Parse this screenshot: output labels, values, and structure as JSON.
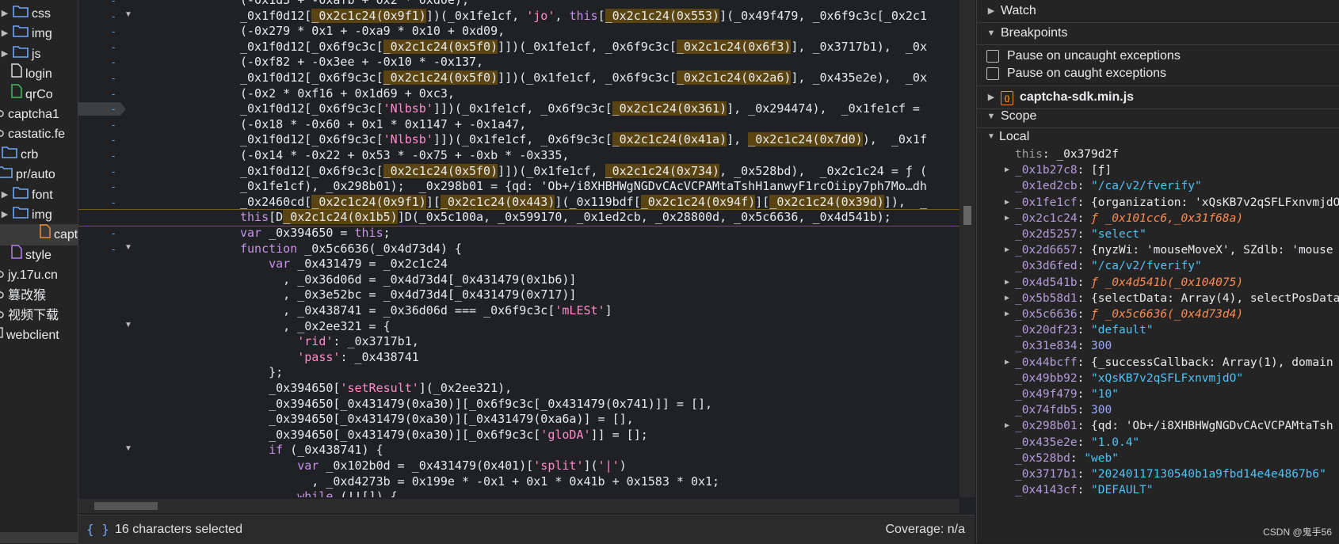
{
  "tree": {
    "items": [
      {
        "label": "css",
        "type": "folder",
        "expand": "▶"
      },
      {
        "label": "img",
        "type": "folder",
        "expand": "▶"
      },
      {
        "label": "js",
        "type": "folder",
        "expand": "▶"
      },
      {
        "label": "login",
        "type": "file-white",
        "expand": ""
      },
      {
        "label": "qrCo",
        "type": "file-green",
        "expand": ""
      },
      {
        "label": "captcha1",
        "type": "cloud",
        "expand": ""
      },
      {
        "label": "castatic.fe",
        "type": "cloud",
        "expand": ""
      },
      {
        "label": "crb",
        "type": "folder",
        "expand": "▶"
      },
      {
        "label": "pr/auto",
        "type": "folder",
        "expand": "▼"
      },
      {
        "label": "font",
        "type": "folder",
        "expand": "▶"
      },
      {
        "label": "img",
        "type": "folder",
        "expand": "▶"
      },
      {
        "label": "capto",
        "type": "file-orange",
        "expand": ""
      },
      {
        "label": "style",
        "type": "file-purple",
        "expand": ""
      },
      {
        "label": "jy.17u.cn",
        "type": "cloud",
        "expand": ""
      },
      {
        "label": "篡改猴",
        "type": "cloud",
        "expand": ""
      },
      {
        "label": "视频下载",
        "type": "cloud",
        "expand": ""
      },
      {
        "label": "webclient",
        "type": "square",
        "expand": ""
      }
    ]
  },
  "code_lines": [
    {
      "text": "(-0x1d3 + -0xafb + 0x2 * 0xd0e),",
      "hl": false
    },
    {
      "text": "_0x1f0d12[_0x2c1c24(0x9f1)])(_0x1fe1cf, 'jo', this[_0x2c1c24(0x553)](_0x49f479, _0x6f9c3c[_0x2c1",
      "hl": false
    },
    {
      "text": "(-0x279 * 0x1 + -0xa9 * 0x10 + 0xd09,",
      "hl": false
    },
    {
      "text": "_0x1f0d12[_0x6f9c3c[_0x2c1c24(0x5f0)]])(_0x1fe1cf, _0x6f9c3c[_0x2c1c24(0x6f3)], _0x3717b1),  _0x",
      "hl": false
    },
    {
      "text": "(-0xf82 + -0x3ee + -0x10 * -0x137,",
      "hl": false
    },
    {
      "text": "_0x1f0d12[_0x6f9c3c[_0x2c1c24(0x5f0)]])(_0x1fe1cf, _0x6f9c3c[_0x2c1c24(0x2a6)], _0x435e2e),  _0x",
      "hl": false
    },
    {
      "text": "(-0x2 * 0xf16 + 0x1d69 + 0xc3,",
      "hl": false
    },
    {
      "text": "_0x1f0d12[_0x6f9c3c['Nlbsb']])(_0x1fe1cf, _0x6f9c3c[_0x2c1c24(0x361)], _0x294474),  _0x1fe1cf =",
      "hl": false
    },
    {
      "text": "(-0x18 * -0x60 + 0x1 * 0x1147 + -0x1a47,",
      "hl": false
    },
    {
      "text": "_0x1f0d12[_0x6f9c3c['Nlbsb']])(_0x1fe1cf, _0x6f9c3c[_0x2c1c24(0x41a)], _0x2c1c24(0x7d0)),  _0x1f",
      "hl": false
    },
    {
      "text": "(-0x14 * -0x22 + 0x53 * -0x75 + -0xb * -0x335,",
      "hl": false
    },
    {
      "text": "_0x1f0d12[_0x6f9c3c[_0x2c1c24(0x5f0)]])(_0x1fe1cf, _0x2c1c24(0x734), _0x528bd),  _0x2c1c24 = ƒ (",
      "hl": false
    },
    {
      "text": "_0x1fe1cf), _0x298b01);  _0x298b01 = {qd: 'Ob+/i8XHBHWgNGDvCAcVCPAMtaTshH1anwyF1rcOiipy7ph7Mo…dh",
      "hl": false
    },
    {
      "text": "_0x2460cd[_0x2c1c24(0x9f1)][_0x2c1c24(0x443)](_0x119bdf[_0x2c1c24(0x94f)][_0x2c1c24(0x39d)]),  _",
      "hl": false
    },
    {
      "text": "this[D_0x2c1c24(0x1b5)]D(_0x5c100a, _0x599170, _0x1ed2cb, _0x28800d, _0x5c6636, _0x4d541b);",
      "hl": true
    },
    {
      "text": "var _0x394650 = this;",
      "hl": false
    },
    {
      "text": "function _0x5c6636(_0x4d73d4) {",
      "hl": false
    },
    {
      "text": "    var _0x431479 = _0x2c1c24",
      "hl": false
    },
    {
      "text": "      , _0x36d06d = _0x4d73d4[_0x431479(0x1b6)]",
      "hl": false
    },
    {
      "text": "      , _0x3e52bc = _0x4d73d4[_0x431479(0x717)]",
      "hl": false
    },
    {
      "text": "      , _0x438741 = _0x36d06d === _0x6f9c3c['mLESt']",
      "hl": false
    },
    {
      "text": "      , _0x2ee321 = {",
      "hl": false
    },
    {
      "text": "        'rid': _0x3717b1,",
      "hl": false
    },
    {
      "text": "        'pass': _0x438741",
      "hl": false
    },
    {
      "text": "    };",
      "hl": false
    },
    {
      "text": "    _0x394650['setResult'](_0x2ee321),",
      "hl": false
    },
    {
      "text": "    _0x394650[_0x431479(0xa30)][_0x6f9c3c[_0x431479(0x741)]] = [],",
      "hl": false
    },
    {
      "text": "    _0x394650[_0x431479(0xa30)][_0x431479(0xa6a)] = [],",
      "hl": false
    },
    {
      "text": "    _0x394650[_0x431479(0xa30)][_0x6f9c3c['gloDA']] = [];",
      "hl": false
    },
    {
      "text": "    if (_0x438741) {",
      "hl": false
    },
    {
      "text": "        var _0x102b0d = _0x431479(0x401)['split']('|')",
      "hl": false
    },
    {
      "text": "          , _0xd4273b = 0x199e * -0x1 + 0x1 * 0x41b + 0x1583 * 0x1;",
      "hl": false
    },
    {
      "text": "        while (!![]) {",
      "hl": false
    }
  ],
  "status": {
    "braces": "{ }",
    "selection": "16 characters selected",
    "coverage": "Coverage: n/a"
  },
  "right": {
    "watch": "Watch",
    "breakpoints": "Breakpoints",
    "pause_uncaught": "Pause on uncaught exceptions",
    "pause_caught": "Pause on caught exceptions",
    "bp_file": "captcha-sdk.min.js",
    "scope": "Scope",
    "local": "Local",
    "scope_vars": [
      {
        "key": "this",
        "val": "_0x379d2f",
        "kind": "o",
        "exp": false,
        "dim": true
      },
      {
        "key": "_0x1b27c8",
        "val": "[ƒ]",
        "kind": "o",
        "exp": true
      },
      {
        "key": "_0x1ed2cb",
        "val": "\"/ca/v2/fverify\"",
        "kind": "s",
        "exp": false
      },
      {
        "key": "_0x1fe1cf",
        "val": "{organization: 'xQsKB7v2qSFLFxnvmjdO'",
        "kind": "o",
        "exp": true
      },
      {
        "key": "_0x2c1c24",
        "val": "ƒ _0x101cc6,_0x31f68a)",
        "kind": "f",
        "exp": true
      },
      {
        "key": "_0x2d5257",
        "val": "\"select\"",
        "kind": "s",
        "exp": false
      },
      {
        "key": "_0x2d6657",
        "val": "{nyzWi: 'mouseMoveX', SZdlb: 'mouse",
        "kind": "o",
        "exp": true
      },
      {
        "key": "_0x3d6fed",
        "val": "\"/ca/v2/fverify\"",
        "kind": "s",
        "exp": false
      },
      {
        "key": "_0x4d541b",
        "val": "ƒ _0x4d541b(_0x104075)",
        "kind": "f",
        "exp": true
      },
      {
        "key": "_0x5b58d1",
        "val": "{selectData: Array(4), selectPosData",
        "kind": "o",
        "exp": true
      },
      {
        "key": "_0x5c6636",
        "val": "ƒ _0x5c6636(_0x4d73d4)",
        "kind": "f",
        "exp": true
      },
      {
        "key": "_0x20df23",
        "val": "\"default\"",
        "kind": "s",
        "exp": false
      },
      {
        "key": "_0x31e834",
        "val": "300",
        "kind": "n",
        "exp": false
      },
      {
        "key": "_0x44bcff",
        "val": "{_successCallback: Array(1), domain",
        "kind": "o",
        "exp": true
      },
      {
        "key": "_0x49bb92",
        "val": "\"xQsKB7v2qSFLFxnvmjdO\"",
        "kind": "s",
        "exp": false
      },
      {
        "key": "_0x49f479",
        "val": "\"10\"",
        "kind": "s",
        "exp": false
      },
      {
        "key": "_0x74fdb5",
        "val": "300",
        "kind": "n",
        "exp": false
      },
      {
        "key": "_0x298b01",
        "val": "{qd: 'Ob+/i8XHBHWgNGDvCAcVCPAMtaTsh",
        "kind": "o",
        "exp": true
      },
      {
        "key": "_0x435e2e",
        "val": "\"1.0.4\"",
        "kind": "s",
        "exp": false
      },
      {
        "key": "_0x528bd",
        "val": "\"web\"",
        "kind": "s",
        "exp": false
      },
      {
        "key": "_0x3717b1",
        "val": "\"20240117130540b1a9fbd14e4e4867b6\"",
        "kind": "s",
        "exp": false
      },
      {
        "key": "_0x4143cf",
        "val": "\"DEFAULT\"",
        "kind": "s",
        "exp": false
      }
    ],
    "watermark": "CSDN @鬼手56"
  },
  "colors": {
    "accent": "#3f6fd0",
    "highlight": "#5a4512",
    "string": "#4fc3f7",
    "keyword": "#c792ea"
  }
}
